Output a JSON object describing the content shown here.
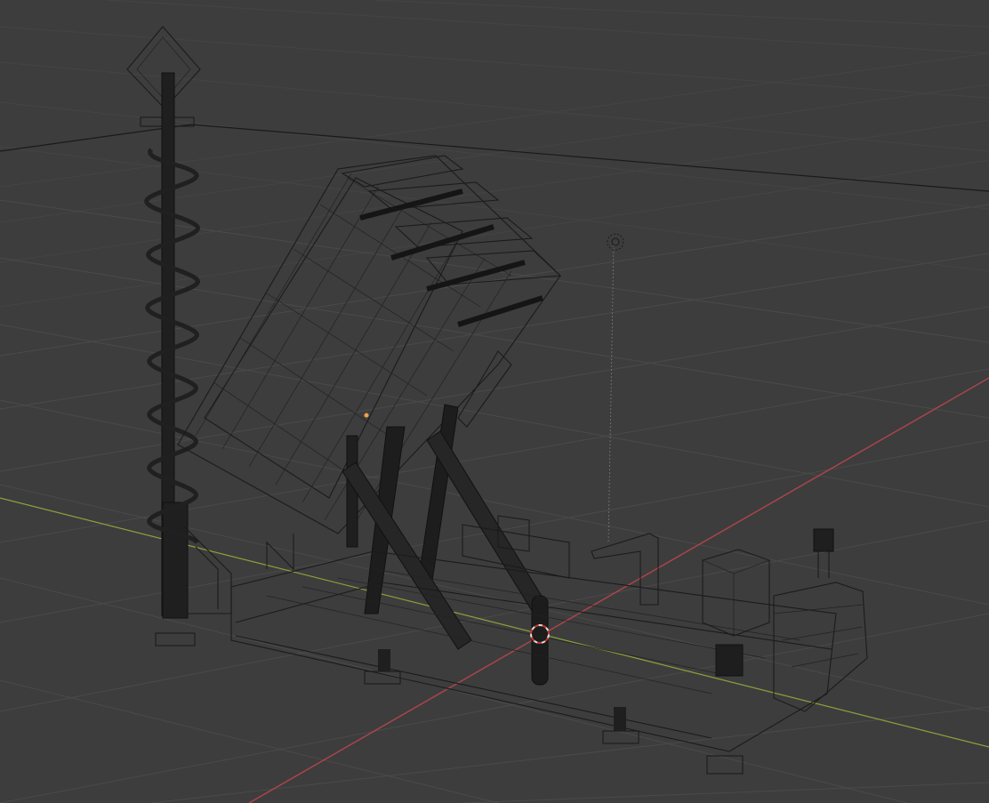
{
  "viewport": {
    "background": "#3d3d3d",
    "grid_color": "#4a4a4a",
    "x_axis_color": "#b0454b",
    "y_axis_color": "#8aa33b",
    "selected_origin_color": "#f0a050",
    "cursor_color": "#e0e0e0",
    "display_mode": "wireframe",
    "objects": [
      "antenna-mast",
      "launcher-canister-array",
      "support-struts",
      "trailer-platform",
      "electronics-cabinet",
      "light-object",
      "3d-cursor"
    ]
  }
}
